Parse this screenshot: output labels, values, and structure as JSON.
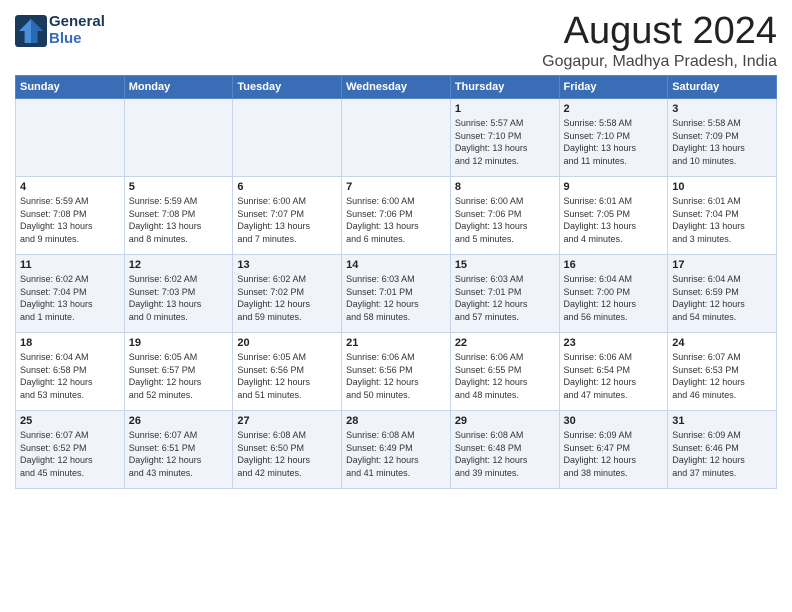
{
  "logo": {
    "name": "General",
    "name2": "Blue"
  },
  "header": {
    "title": "August 2024",
    "subtitle": "Gogapur, Madhya Pradesh, India"
  },
  "days_of_week": [
    "Sunday",
    "Monday",
    "Tuesday",
    "Wednesday",
    "Thursday",
    "Friday",
    "Saturday"
  ],
  "weeks": [
    {
      "days": [
        {
          "num": "",
          "info": ""
        },
        {
          "num": "",
          "info": ""
        },
        {
          "num": "",
          "info": ""
        },
        {
          "num": "",
          "info": ""
        },
        {
          "num": "1",
          "info": "Sunrise: 5:57 AM\nSunset: 7:10 PM\nDaylight: 13 hours\nand 12 minutes."
        },
        {
          "num": "2",
          "info": "Sunrise: 5:58 AM\nSunset: 7:10 PM\nDaylight: 13 hours\nand 11 minutes."
        },
        {
          "num": "3",
          "info": "Sunrise: 5:58 AM\nSunset: 7:09 PM\nDaylight: 13 hours\nand 10 minutes."
        }
      ]
    },
    {
      "days": [
        {
          "num": "4",
          "info": "Sunrise: 5:59 AM\nSunset: 7:08 PM\nDaylight: 13 hours\nand 9 minutes."
        },
        {
          "num": "5",
          "info": "Sunrise: 5:59 AM\nSunset: 7:08 PM\nDaylight: 13 hours\nand 8 minutes."
        },
        {
          "num": "6",
          "info": "Sunrise: 6:00 AM\nSunset: 7:07 PM\nDaylight: 13 hours\nand 7 minutes."
        },
        {
          "num": "7",
          "info": "Sunrise: 6:00 AM\nSunset: 7:06 PM\nDaylight: 13 hours\nand 6 minutes."
        },
        {
          "num": "8",
          "info": "Sunrise: 6:00 AM\nSunset: 7:06 PM\nDaylight: 13 hours\nand 5 minutes."
        },
        {
          "num": "9",
          "info": "Sunrise: 6:01 AM\nSunset: 7:05 PM\nDaylight: 13 hours\nand 4 minutes."
        },
        {
          "num": "10",
          "info": "Sunrise: 6:01 AM\nSunset: 7:04 PM\nDaylight: 13 hours\nand 3 minutes."
        }
      ]
    },
    {
      "days": [
        {
          "num": "11",
          "info": "Sunrise: 6:02 AM\nSunset: 7:04 PM\nDaylight: 13 hours\nand 1 minute."
        },
        {
          "num": "12",
          "info": "Sunrise: 6:02 AM\nSunset: 7:03 PM\nDaylight: 13 hours\nand 0 minutes."
        },
        {
          "num": "13",
          "info": "Sunrise: 6:02 AM\nSunset: 7:02 PM\nDaylight: 12 hours\nand 59 minutes."
        },
        {
          "num": "14",
          "info": "Sunrise: 6:03 AM\nSunset: 7:01 PM\nDaylight: 12 hours\nand 58 minutes."
        },
        {
          "num": "15",
          "info": "Sunrise: 6:03 AM\nSunset: 7:01 PM\nDaylight: 12 hours\nand 57 minutes."
        },
        {
          "num": "16",
          "info": "Sunrise: 6:04 AM\nSunset: 7:00 PM\nDaylight: 12 hours\nand 56 minutes."
        },
        {
          "num": "17",
          "info": "Sunrise: 6:04 AM\nSunset: 6:59 PM\nDaylight: 12 hours\nand 54 minutes."
        }
      ]
    },
    {
      "days": [
        {
          "num": "18",
          "info": "Sunrise: 6:04 AM\nSunset: 6:58 PM\nDaylight: 12 hours\nand 53 minutes."
        },
        {
          "num": "19",
          "info": "Sunrise: 6:05 AM\nSunset: 6:57 PM\nDaylight: 12 hours\nand 52 minutes."
        },
        {
          "num": "20",
          "info": "Sunrise: 6:05 AM\nSunset: 6:56 PM\nDaylight: 12 hours\nand 51 minutes."
        },
        {
          "num": "21",
          "info": "Sunrise: 6:06 AM\nSunset: 6:56 PM\nDaylight: 12 hours\nand 50 minutes."
        },
        {
          "num": "22",
          "info": "Sunrise: 6:06 AM\nSunset: 6:55 PM\nDaylight: 12 hours\nand 48 minutes."
        },
        {
          "num": "23",
          "info": "Sunrise: 6:06 AM\nSunset: 6:54 PM\nDaylight: 12 hours\nand 47 minutes."
        },
        {
          "num": "24",
          "info": "Sunrise: 6:07 AM\nSunset: 6:53 PM\nDaylight: 12 hours\nand 46 minutes."
        }
      ]
    },
    {
      "days": [
        {
          "num": "25",
          "info": "Sunrise: 6:07 AM\nSunset: 6:52 PM\nDaylight: 12 hours\nand 45 minutes."
        },
        {
          "num": "26",
          "info": "Sunrise: 6:07 AM\nSunset: 6:51 PM\nDaylight: 12 hours\nand 43 minutes."
        },
        {
          "num": "27",
          "info": "Sunrise: 6:08 AM\nSunset: 6:50 PM\nDaylight: 12 hours\nand 42 minutes."
        },
        {
          "num": "28",
          "info": "Sunrise: 6:08 AM\nSunset: 6:49 PM\nDaylight: 12 hours\nand 41 minutes."
        },
        {
          "num": "29",
          "info": "Sunrise: 6:08 AM\nSunset: 6:48 PM\nDaylight: 12 hours\nand 39 minutes."
        },
        {
          "num": "30",
          "info": "Sunrise: 6:09 AM\nSunset: 6:47 PM\nDaylight: 12 hours\nand 38 minutes."
        },
        {
          "num": "31",
          "info": "Sunrise: 6:09 AM\nSunset: 6:46 PM\nDaylight: 12 hours\nand 37 minutes."
        }
      ]
    }
  ]
}
